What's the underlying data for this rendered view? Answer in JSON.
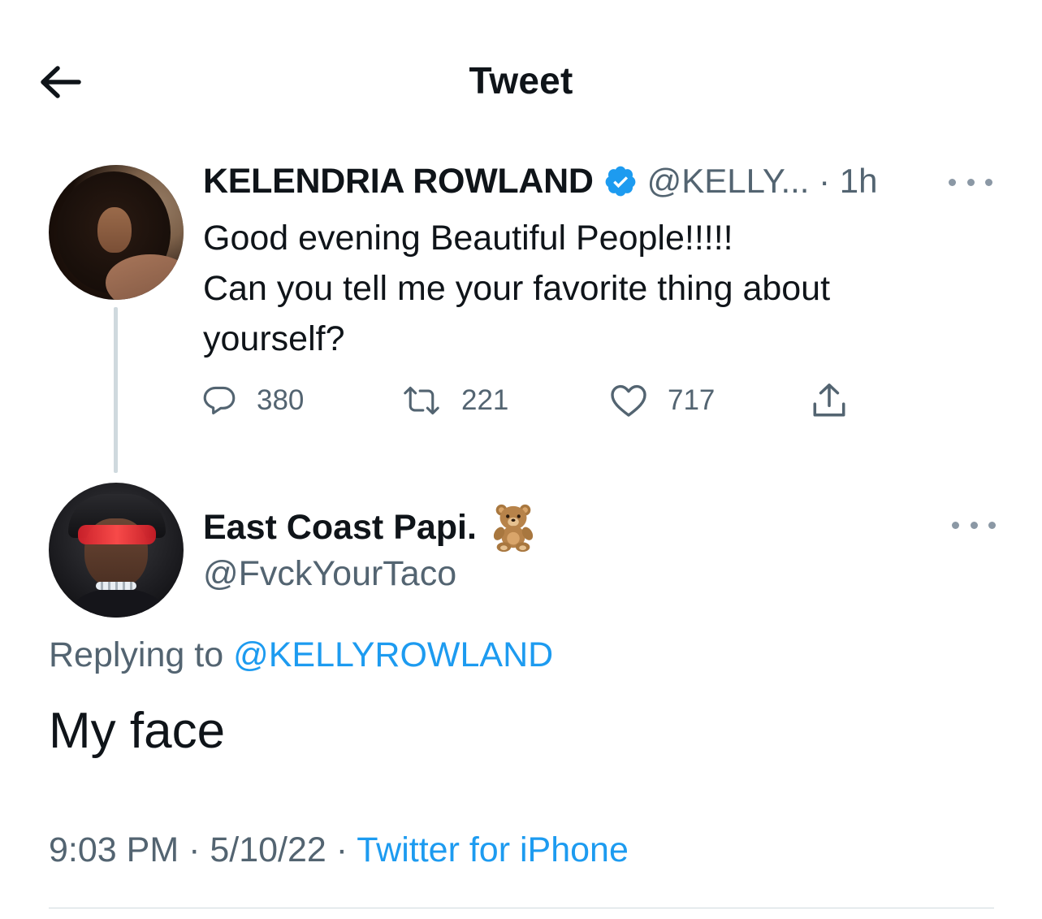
{
  "header": {
    "title": "Tweet",
    "back_icon": "arrow-left-icon"
  },
  "parent_tweet": {
    "display_name": "KELENDRIA ROWLAND",
    "verified": true,
    "handle_time": "@KELLY... · 1h",
    "text": "Good evening Beautiful People!!!!!\nCan you tell me your favorite thing about yourself?",
    "actions": {
      "reply_count": "380",
      "retweet_count": "221",
      "like_count": "717"
    }
  },
  "reply_tweet": {
    "display_name": "East Coast Papi.",
    "emoji": "🧸",
    "handle": "@FvckYourTaco",
    "replying_label": "Replying to ",
    "replying_mention": "@KELLYROWLAND",
    "text": "My face",
    "time": "9:03 PM · 5/10/22 · ",
    "source": "Twitter for iPhone"
  },
  "colors": {
    "text": "#0f1419",
    "secondary": "#536471",
    "accent": "#1d9bf0",
    "divider": "#cfd9de"
  }
}
